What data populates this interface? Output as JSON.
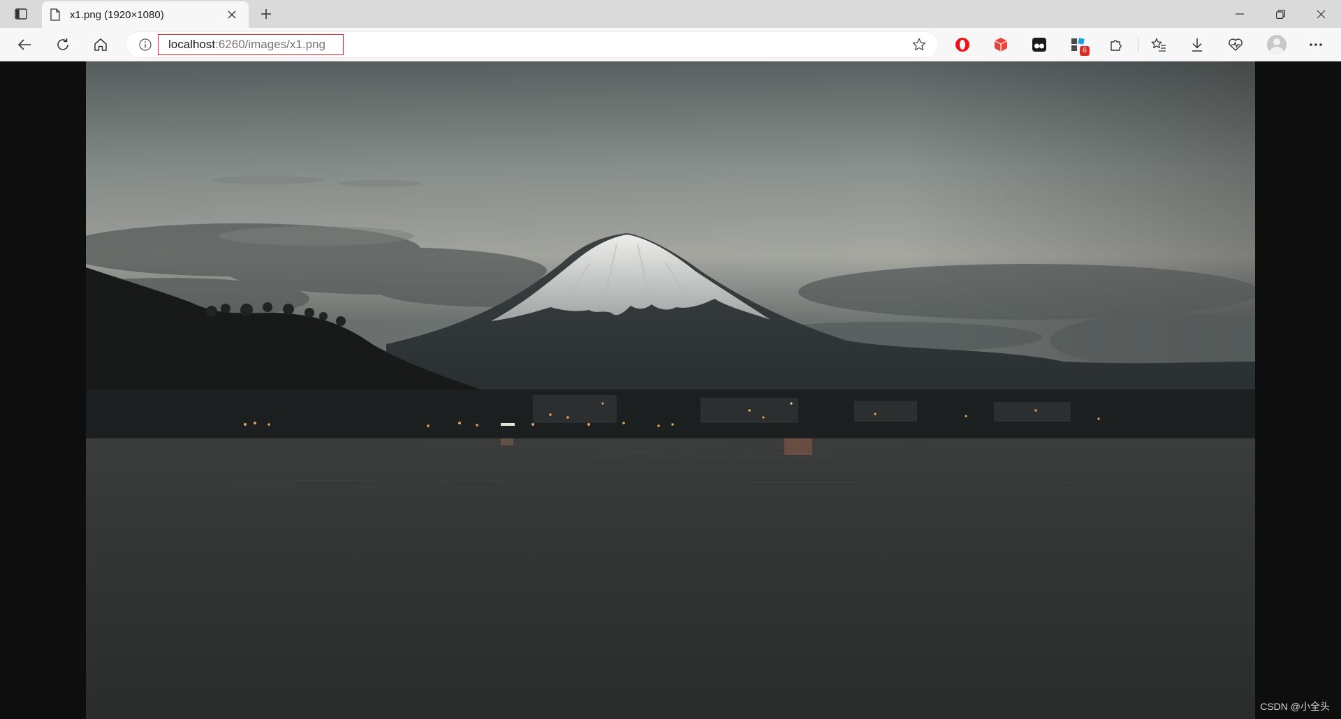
{
  "tab": {
    "title": "x1.png (1920×1080)"
  },
  "address": {
    "host": "localhost",
    "rest": ":6260/images/x1.png"
  },
  "toolbar": {
    "extension_badge": "6"
  },
  "image": {
    "description_icon": "image-viewer"
  },
  "watermark": "CSDN @小全头",
  "colors": {
    "tabstrip": "#dadada",
    "toolbar": "#f7f7f7",
    "viewer_bg": "#0e0e0e",
    "highlight_box": "#e0252b"
  }
}
